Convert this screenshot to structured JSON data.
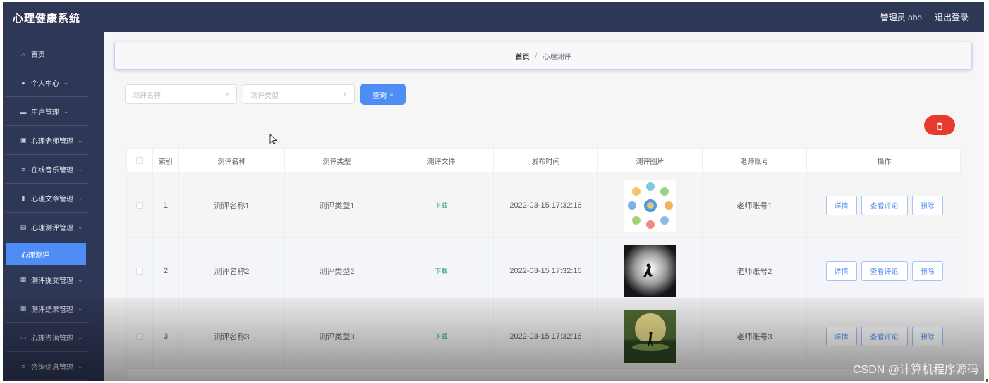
{
  "app": {
    "title": "心理健康系统"
  },
  "header": {
    "user": "管理员 abo",
    "logout": "退出登录"
  },
  "sidebar": {
    "items": [
      {
        "label": "首页",
        "icon": "home-icon",
        "has_children": false
      },
      {
        "label": "个人中心",
        "icon": "user-icon",
        "has_children": true
      },
      {
        "label": "用户管理",
        "icon": "users-icon",
        "has_children": true
      },
      {
        "label": "心理老师管理",
        "icon": "clipboard-icon",
        "has_children": true
      },
      {
        "label": "在线音乐管理",
        "icon": "list-icon",
        "has_children": true
      },
      {
        "label": "心理文章管理",
        "icon": "chart-icon",
        "has_children": true
      },
      {
        "label": "心理测评管理",
        "icon": "doc-icon",
        "has_children": true
      },
      {
        "label": "测评提交管理",
        "icon": "grid-icon",
        "has_children": true
      },
      {
        "label": "测评结果管理",
        "icon": "grid-icon",
        "has_children": true
      },
      {
        "label": "心理咨询管理",
        "icon": "chat-icon",
        "has_children": true
      },
      {
        "label": "咨询信息管理",
        "icon": "list-icon",
        "has_children": true
      }
    ],
    "active_sub": "心理测评"
  },
  "breadcrumb": {
    "home": "首页",
    "sep": "/",
    "current": "心理测评"
  },
  "search": {
    "name_placeholder": "测评名称",
    "type_placeholder": "测评类型",
    "query_label": "查询"
  },
  "table": {
    "headers": [
      "索引",
      "测评名称",
      "测评类型",
      "测评文件",
      "发布时间",
      "测评图片",
      "老师账号",
      "操作"
    ],
    "rows": [
      {
        "index": "1",
        "name": "测评名称1",
        "type": "测评类型1",
        "file": "下载",
        "time": "2022-03-15 17:32:16",
        "image": "network",
        "teacher": "老师账号1"
      },
      {
        "index": "2",
        "name": "测评名称2",
        "type": "测评类型2",
        "file": "下载",
        "time": "2022-03-15 17:32:16",
        "image": "spotlight",
        "teacher": "老师账号2"
      },
      {
        "index": "3",
        "name": "测评名称3",
        "type": "测评类型3",
        "file": "下载",
        "time": "2022-03-15 17:32:16",
        "image": "moon",
        "teacher": "老师账号3"
      }
    ],
    "actions": {
      "detail": "详情",
      "comments": "查看评论",
      "delete": "删除"
    }
  },
  "watermark": "CSDN @计算机程序源码",
  "colors": {
    "nav": "#2f3756",
    "primary": "#4f8df6",
    "danger": "#e53a2c",
    "download": "#27a567"
  }
}
